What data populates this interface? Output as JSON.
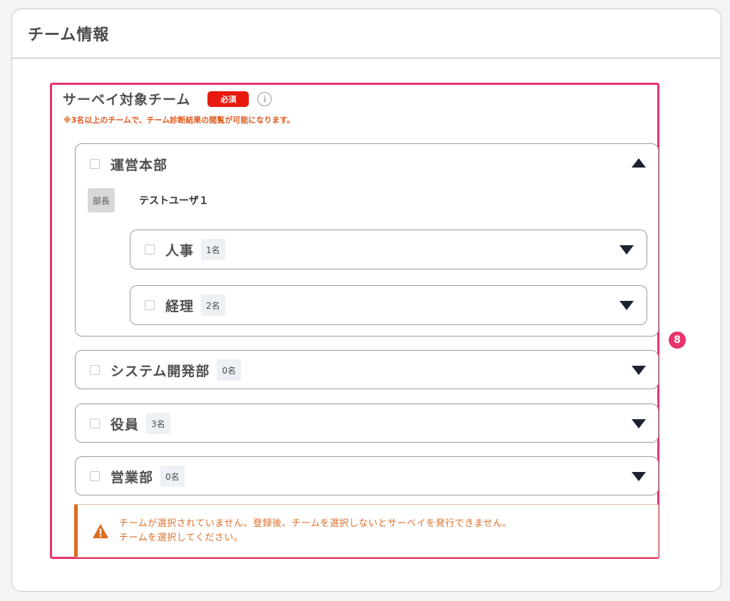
{
  "card": {
    "title": "チーム情報"
  },
  "marker": {
    "number": "8"
  },
  "section": {
    "title": "サーベイ対象チーム",
    "required_label": "必須",
    "info_icon": "i",
    "note": "※3名以上のチームで、チーム診断結果の閲覧が可能になります。"
  },
  "teams": {
    "unei": {
      "name": "運営本部",
      "expanded": true,
      "role": "部長",
      "member": "テストユーザ１",
      "children": [
        {
          "name": "人事",
          "count": "1名"
        },
        {
          "name": "経理",
          "count": "2名"
        }
      ]
    },
    "system": {
      "name": "システム開発部",
      "count": "0名"
    },
    "yakuin": {
      "name": "役員",
      "count": "3名"
    },
    "eigyo": {
      "name": "営業部",
      "count": "0名"
    }
  },
  "warning": {
    "line1": "チームが選択されていません。登録後、チームを選択しないとサーベイを発行できません。",
    "line2": "チームを選択してください。"
  },
  "colors": {
    "highlight": "#e8336b",
    "required": "#e8190f",
    "note": "#e05a1f",
    "warning": "#e06a20"
  }
}
